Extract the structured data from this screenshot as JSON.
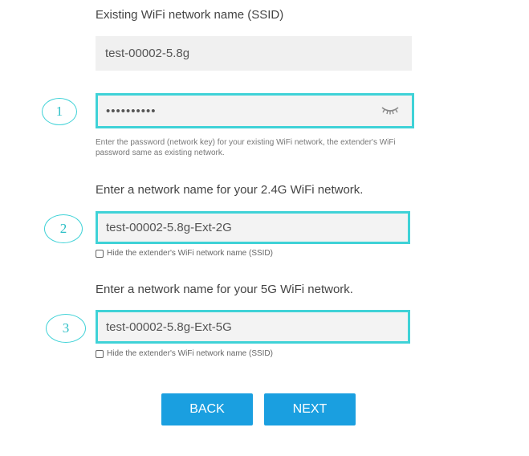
{
  "existing_network": {
    "label": "Existing WiFi network name (SSID)",
    "ssid_value": "test-00002-5.8g"
  },
  "password": {
    "step_number": "1",
    "value": "••••••••••",
    "icon": "eye-closed-icon",
    "help_text": "Enter the password (network key) for your existing WiFi network, the extender's WiFi password same as existing network."
  },
  "network_2g": {
    "label": "Enter a network name for your 2.4G WiFi network.",
    "step_number": "2",
    "ssid_value": "test-00002-5.8g-Ext-2G",
    "hide_ssid_label": "Hide the extender's WiFi network name (SSID)",
    "hide_ssid_checked": false
  },
  "network_5g": {
    "label": "Enter a network name for your 5G WiFi network.",
    "step_number": "3",
    "ssid_value": "test-00002-5.8g-Ext-5G",
    "hide_ssid_label": "Hide the extender's WiFi network name (SSID)",
    "hide_ssid_checked": false
  },
  "buttons": {
    "back_label": "BACK",
    "next_label": "NEXT"
  },
  "colors": {
    "accent_cyan": "#3fd2d7",
    "button_blue": "#1a9fe0",
    "field_background": "#f0f0f0"
  }
}
